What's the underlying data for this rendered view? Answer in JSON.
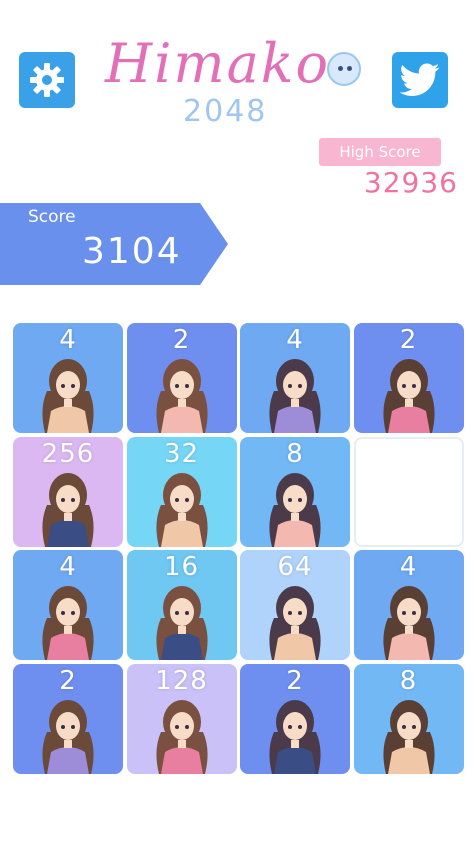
{
  "header": {
    "title": "Himako",
    "subtitle": "2048",
    "settings_icon": "gear-icon",
    "twitter_icon": "twitter-bird-icon"
  },
  "high_score": {
    "label": "High Score",
    "value": "32936"
  },
  "score": {
    "label": "Score",
    "value": "3104"
  },
  "board": {
    "tiles": [
      {
        "value": "4",
        "color": "#6fa9f2"
      },
      {
        "value": "2",
        "color": "#6f8ff0"
      },
      {
        "value": "4",
        "color": "#6fa9f2"
      },
      {
        "value": "2",
        "color": "#6f8ff0"
      },
      {
        "value": "256",
        "color": "#dcb8f3"
      },
      {
        "value": "32",
        "color": "#75d6f5"
      },
      {
        "value": "8",
        "color": "#72b8f4"
      },
      {
        "value": "",
        "color": "#ffffff"
      },
      {
        "value": "4",
        "color": "#6fa9f2"
      },
      {
        "value": "16",
        "color": "#6ec8f2"
      },
      {
        "value": "64",
        "color": "#b0d3fb"
      },
      {
        "value": "4",
        "color": "#6fa9f2"
      },
      {
        "value": "2",
        "color": "#6f8ff0"
      },
      {
        "value": "128",
        "color": "#c9c1f8"
      },
      {
        "value": "2",
        "color": "#6f8ff0"
      },
      {
        "value": "8",
        "color": "#72b8f4"
      }
    ]
  }
}
